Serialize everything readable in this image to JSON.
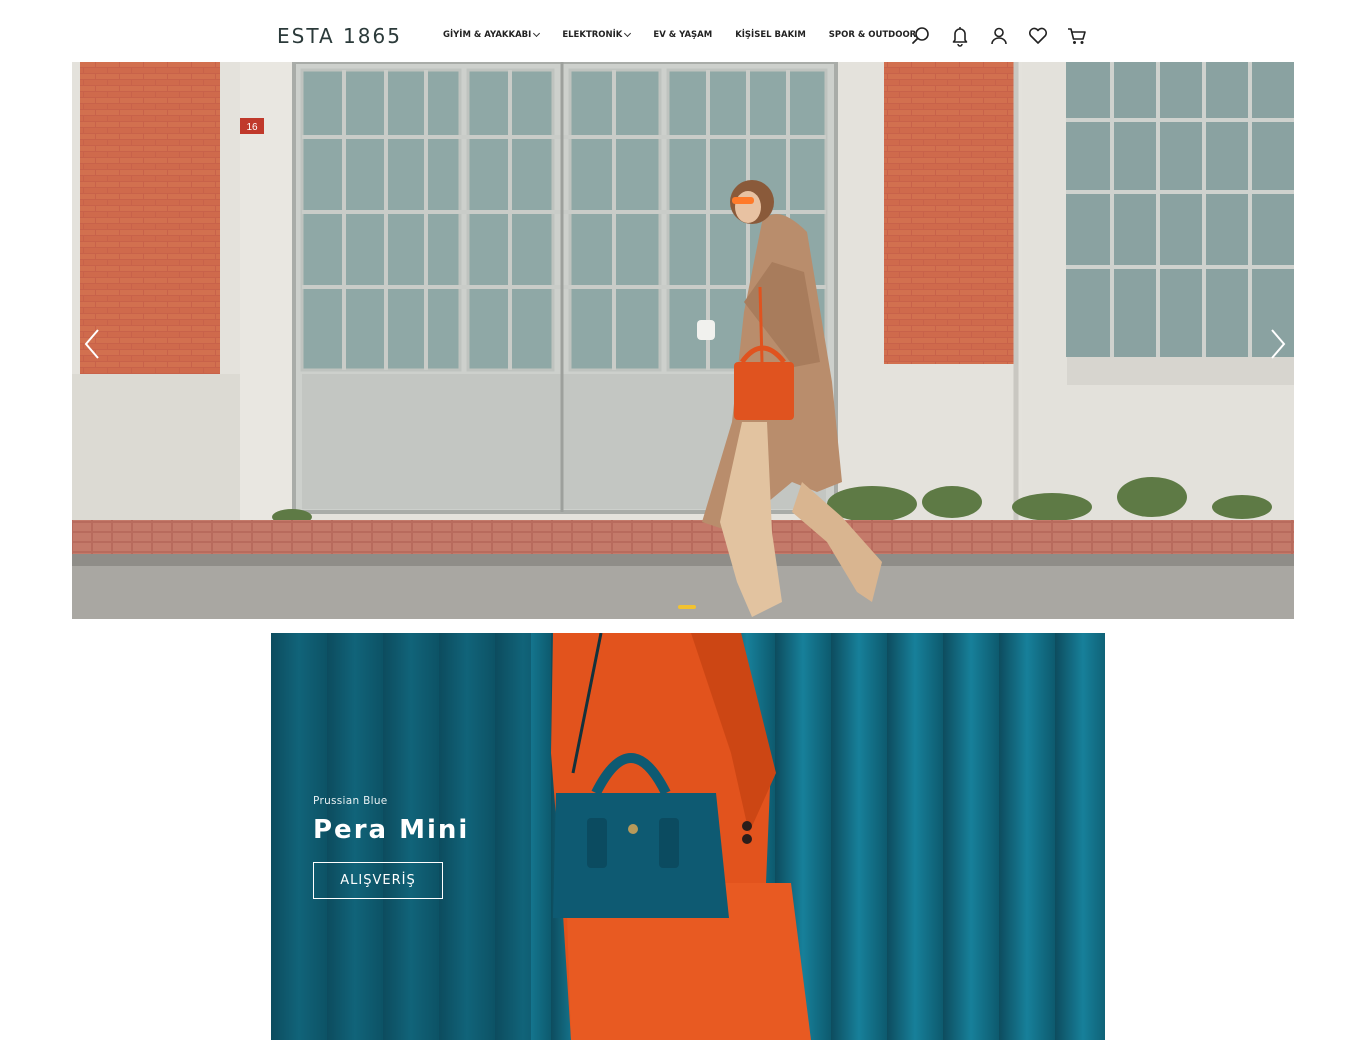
{
  "header": {
    "logo": "ESTA 1865",
    "nav": [
      {
        "label": "GİYİM & AYAKKABI",
        "has_dropdown": true
      },
      {
        "label": "ELEKTRONİK",
        "has_dropdown": true
      },
      {
        "label": "EV & YAŞAM",
        "has_dropdown": false
      },
      {
        "label": "KİŞİSEL BAKIM",
        "has_dropdown": false
      },
      {
        "label": "SPOR & OUTDOOR",
        "has_dropdown": false
      }
    ],
    "icons": [
      "search-icon",
      "bell-icon",
      "user-icon",
      "heart-icon",
      "cart-icon"
    ]
  },
  "hero": {
    "house_number": "16",
    "prev_icon": "chevron-left-icon",
    "next_icon": "chevron-right-icon"
  },
  "banner": {
    "subtitle": "Prussian Blue",
    "title": "Pera Mini",
    "button": "ALIŞVERİŞ"
  },
  "colors": {
    "accent_dot": "#f2c230",
    "banner_bg": "#0f5f72",
    "brick": "#c8624a"
  }
}
